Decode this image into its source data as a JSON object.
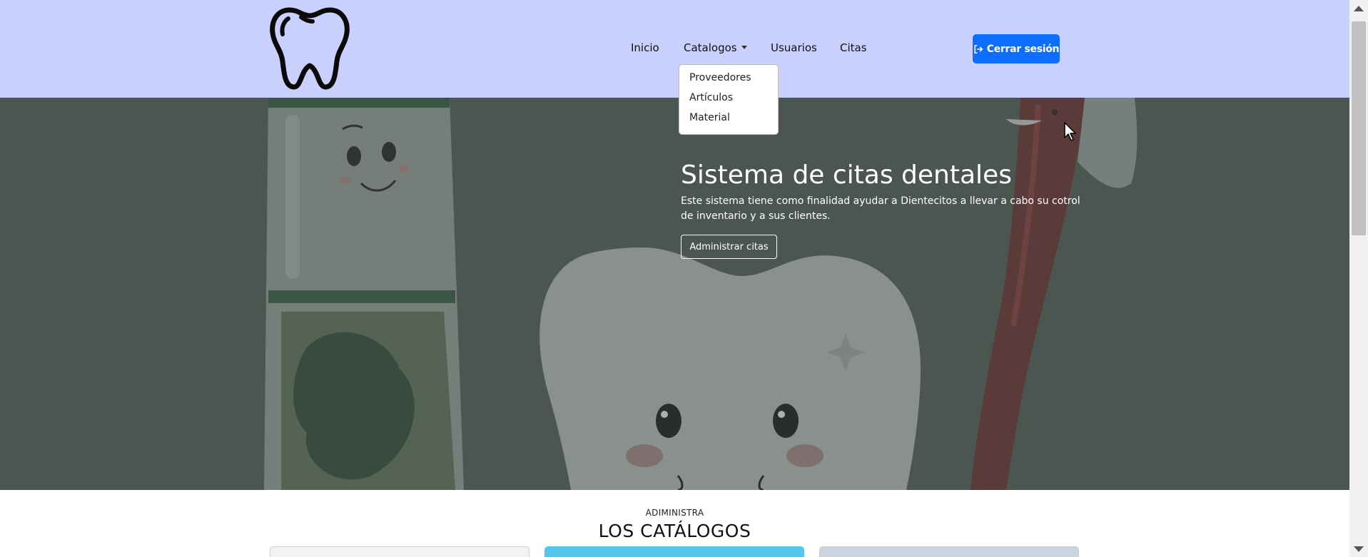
{
  "navbar": {
    "logo_icon": "tooth-icon",
    "links": {
      "inicio": "Inicio",
      "catalogos": "Catalogos",
      "usuarios": "Usuarios",
      "citas": "Citas"
    },
    "logout_label": "Cerrar sesión",
    "logout_icon": "sign-out-icon",
    "background": "#c9d0fc"
  },
  "dropdown": {
    "items": [
      "Proveedores",
      "Artículos",
      "Material"
    ]
  },
  "hero": {
    "title": "Sistema de citas dentales",
    "description": "Este sistema tiene como finalidad ayudar a Dientecitos a llevar a cabo su cotrol de inventario y a sus clientes.",
    "button_label": "Administrar citas",
    "background": "#4f5b57"
  },
  "catalogs": {
    "label": "ADIMINISTRA",
    "title": "LOS CATÁLOGOS"
  },
  "colors": {
    "primary": "#0d6efd",
    "card_cyan": "#56c7ec"
  }
}
